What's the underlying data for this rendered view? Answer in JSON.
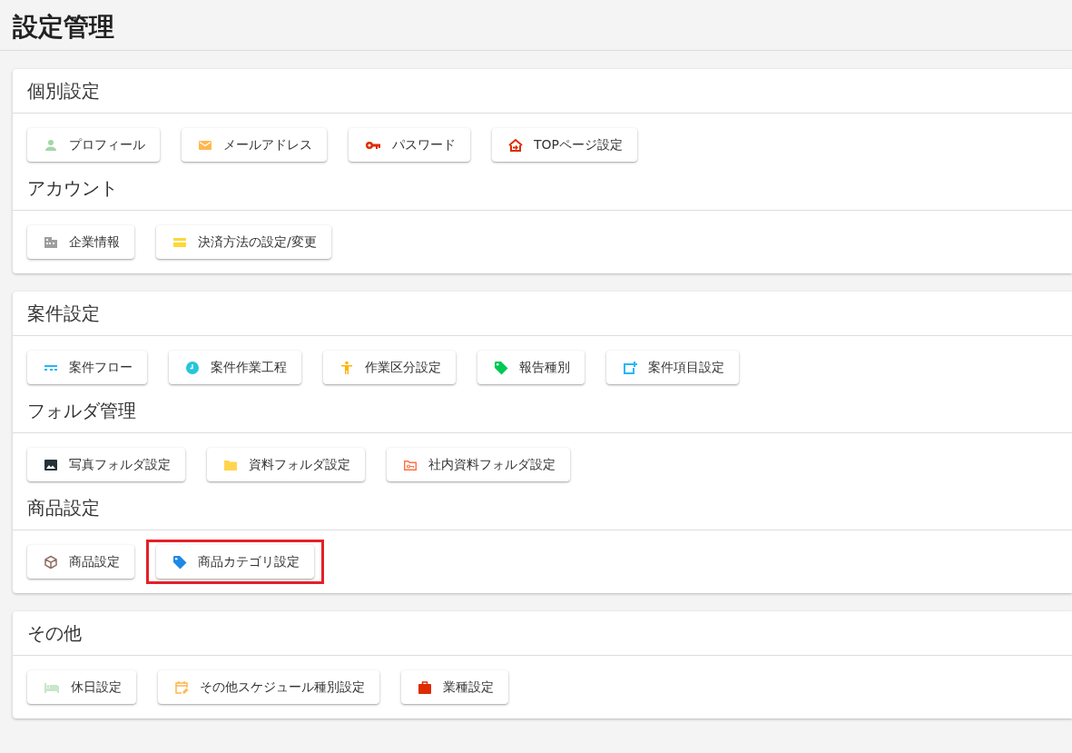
{
  "title": "設定管理",
  "cards": [
    {
      "sections": [
        {
          "heading": "個別設定",
          "buttons": [
            {
              "label": "プロフィール",
              "kind": "person",
              "color": "#a5d6a7",
              "highlighted": false
            },
            {
              "label": "メールアドレス",
              "kind": "mail",
              "color": "#ffb74d",
              "highlighted": false
            },
            {
              "label": "パスワード",
              "kind": "key",
              "color": "#dd2c00",
              "highlighted": false
            },
            {
              "label": "TOPページ設定",
              "kind": "home",
              "color": "#dd2c00",
              "highlighted": false
            }
          ]
        },
        {
          "heading": "アカウント",
          "buttons": [
            {
              "label": "企業情報",
              "kind": "building",
              "color": "#9e9e9e",
              "highlighted": false
            },
            {
              "label": "決済方法の設定/変更",
              "kind": "card",
              "color": "#fdd835",
              "highlighted": false
            }
          ]
        }
      ]
    },
    {
      "sections": [
        {
          "heading": "案件設定",
          "buttons": [
            {
              "label": "案件フロー",
              "kind": "flow",
              "color": "#29b6f6",
              "highlighted": false
            },
            {
              "label": "案件作業工程",
              "kind": "clock",
              "color": "#26c6da",
              "highlighted": false
            },
            {
              "label": "作業区分設定",
              "kind": "figure",
              "color": "#ffb300",
              "highlighted": false
            },
            {
              "label": "報告種別",
              "kind": "tag",
              "color": "#00c853",
              "highlighted": false
            },
            {
              "label": "案件項目設定",
              "kind": "addbox",
              "color": "#29b6f6",
              "highlighted": false
            }
          ]
        },
        {
          "heading": "フォルダ管理",
          "buttons": [
            {
              "label": "写真フォルダ設定",
              "kind": "image",
              "color": "#263238",
              "highlighted": false
            },
            {
              "label": "資料フォルダ設定",
              "kind": "folder",
              "color": "#ffd54f",
              "highlighted": false
            },
            {
              "label": "社内資料フォルダ設定",
              "kind": "keyfolder",
              "color": "#ff7043",
              "highlighted": false
            }
          ]
        },
        {
          "heading": "商品設定",
          "buttons": [
            {
              "label": "商品設定",
              "kind": "cube",
              "color": "#8d6e63",
              "highlighted": false
            },
            {
              "label": "商品カテゴリ設定",
              "kind": "tag",
              "color": "#1e88e5",
              "highlighted": true
            }
          ]
        }
      ]
    },
    {
      "sections": [
        {
          "heading": "その他",
          "buttons": [
            {
              "label": "休日設定",
              "kind": "bed",
              "color": "#c8e6c9",
              "highlighted": false
            },
            {
              "label": "その他スケジュール種別設定",
              "kind": "calendar",
              "color": "#ffb74d",
              "highlighted": false
            },
            {
              "label": "業種設定",
              "kind": "bag",
              "color": "#dd2c00",
              "highlighted": false
            }
          ]
        }
      ]
    }
  ]
}
